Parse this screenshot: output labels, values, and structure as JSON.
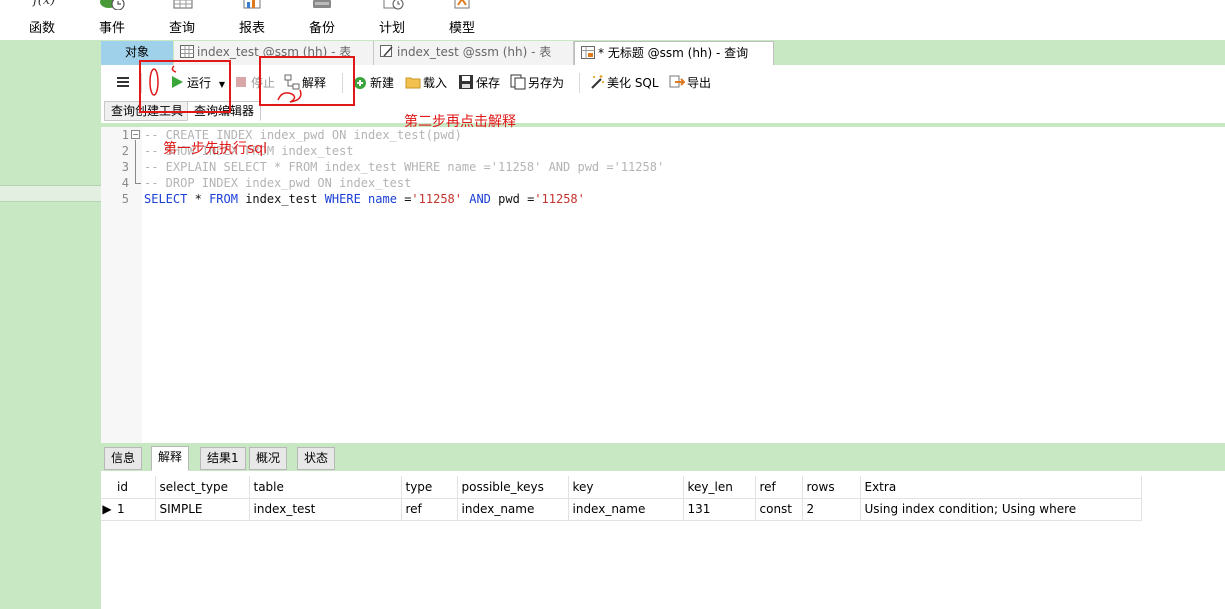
{
  "ribbon": {
    "items": [
      {
        "label": "函数",
        "icon": "function-icon"
      },
      {
        "label": "事件",
        "icon": "event-icon"
      },
      {
        "label": "查询",
        "icon": "query-icon"
      },
      {
        "label": "报表",
        "icon": "report-icon"
      },
      {
        "label": "备份",
        "icon": "backup-icon"
      },
      {
        "label": "计划",
        "icon": "schedule-icon"
      },
      {
        "label": "模型",
        "icon": "model-icon"
      }
    ]
  },
  "tabs": {
    "objects": "对象",
    "items": [
      {
        "label": "index_test @ssm (hh) - 表",
        "icon": "table-icon"
      },
      {
        "label": "index_test @ssm (hh) - 表",
        "icon": "table-design-icon"
      },
      {
        "label": "* 无标题 @ssm (hh) - 查询",
        "icon": "query-tab-icon"
      }
    ]
  },
  "toolbar": {
    "menu_icon": "hamburger-icon",
    "run": "运行",
    "stop": "停止",
    "explain": "解释",
    "new": "新建",
    "load": "载入",
    "save": "保存",
    "save_as": "另存为",
    "beautify": "美化 SQL",
    "export": "导出"
  },
  "subtabs": {
    "builder": "查询创建工具",
    "editor": "查询编辑器"
  },
  "editor": {
    "lines": [
      {
        "num": "1",
        "text": "-- CREATE INDEX index_pwd ON index_test(pwd)"
      },
      {
        "num": "2",
        "text": "-- SHOW INDEX FROM index_test"
      },
      {
        "num": "3",
        "text": "-- EXPLAIN SELECT * FROM index_test WHERE name ='11258' AND pwd ='11258'"
      },
      {
        "num": "4",
        "text": "-- DROP INDEX index_pwd ON index_test"
      },
      {
        "num": "5",
        "text": "SELECT * FROM index_test WHERE name ='11258' AND pwd ='11258'"
      }
    ]
  },
  "results": {
    "tabs": [
      "信息",
      "解释",
      "结果1",
      "概况",
      "状态"
    ],
    "active_tab": "解释",
    "columns": [
      "id",
      "select_type",
      "table",
      "type",
      "possible_keys",
      "key",
      "key_len",
      "ref",
      "rows",
      "Extra"
    ],
    "rows": [
      [
        "1",
        "SIMPLE",
        "index_test",
        "ref",
        "index_name",
        "index_name",
        "131",
        "const",
        "2",
        "Using index condition; Using where"
      ]
    ]
  },
  "annotations": {
    "step1": "第一步先执行sql",
    "step2": "第二步再点击解释"
  },
  "colors": {
    "panel_green": "#c8e8c4",
    "annotation_red": "#e01818",
    "sql_keyword": "#1a3fd6",
    "sql_string": "#c4342d",
    "sql_comment": "#b4b4b4"
  }
}
